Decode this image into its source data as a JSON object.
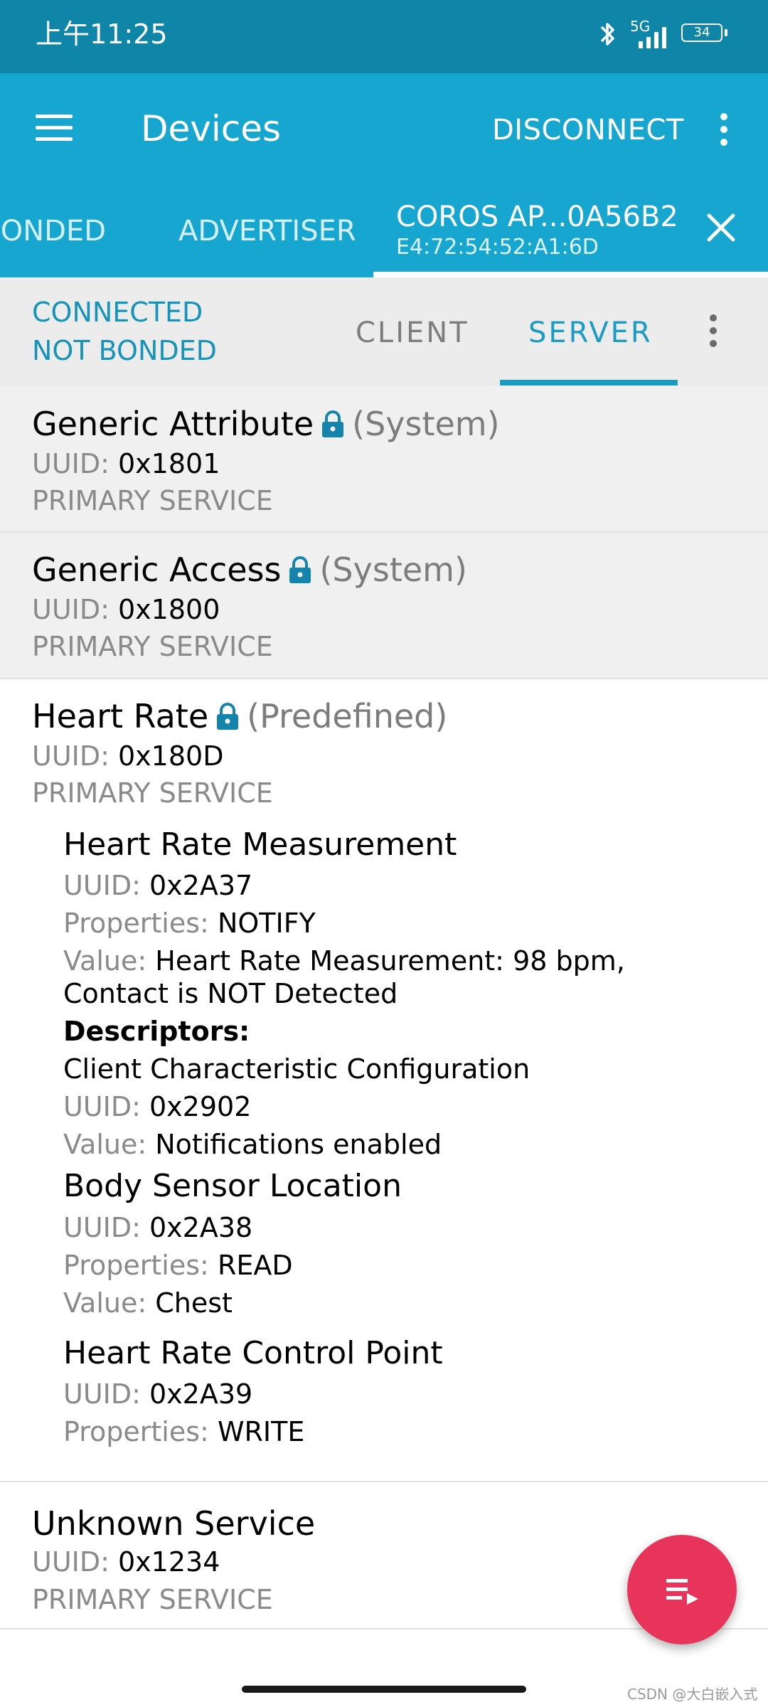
{
  "status_bar": {
    "time": "上午11:25",
    "network": "5G",
    "battery": "34"
  },
  "app_bar": {
    "title": "Devices",
    "disconnect_label": "DISCONNECT"
  },
  "device_tabs": {
    "bonded_label": "BONDED",
    "advertiser_label": "ADVERTISER",
    "active_name": "COROS AP...0A56B2",
    "active_address": "E4:72:54:52:A1:6D"
  },
  "connection": {
    "state": "CONNECTED",
    "bond_state": "NOT BONDED",
    "client_tab": "CLIENT",
    "server_tab": "SERVER"
  },
  "labels": {
    "uuid": "UUID:",
    "properties": "Properties:",
    "value": "Value:",
    "descriptors": "Descriptors:"
  },
  "services": [
    {
      "name": "Generic Attribute",
      "tag": "(System)",
      "uuid": "0x1801",
      "type": "PRIMARY SERVICE"
    },
    {
      "name": "Generic Access",
      "tag": "(System)",
      "uuid": "0x1800",
      "type": "PRIMARY SERVICE"
    },
    {
      "name": "Heart Rate",
      "tag": "(Predefined)",
      "uuid": "0x180D",
      "type": "PRIMARY SERVICE",
      "characteristics": [
        {
          "name": "Heart Rate Measurement",
          "uuid": "0x2A37",
          "properties": "NOTIFY",
          "value_line1": "Heart Rate Measurement: 98 bpm,",
          "value_line2": "Contact is NOT Detected",
          "descriptor": {
            "name": "Client Characteristic Configuration",
            "uuid": "0x2902",
            "value": "Notifications enabled"
          }
        },
        {
          "name": "Body Sensor Location",
          "uuid": "0x2A38",
          "properties": "READ",
          "value": "Chest"
        },
        {
          "name": "Heart Rate Control Point",
          "uuid": "0x2A39",
          "properties": "WRITE"
        }
      ]
    },
    {
      "name": "Unknown Service",
      "uuid": "0x1234",
      "type": "PRIMARY SERVICE"
    }
  ],
  "watermark": "CSDN @大白嵌入式",
  "colors": {
    "status_bar": "#0f85a8",
    "app_bar": "#16a6cf",
    "accent": "#1a9bc1",
    "lock": "#1584ad",
    "fab": "#e8335a"
  },
  "icons": [
    "menu-icon",
    "more-vert-icon",
    "close-icon",
    "lock-icon",
    "bluetooth-icon",
    "signal-icon",
    "battery-icon",
    "queue-icon"
  ]
}
